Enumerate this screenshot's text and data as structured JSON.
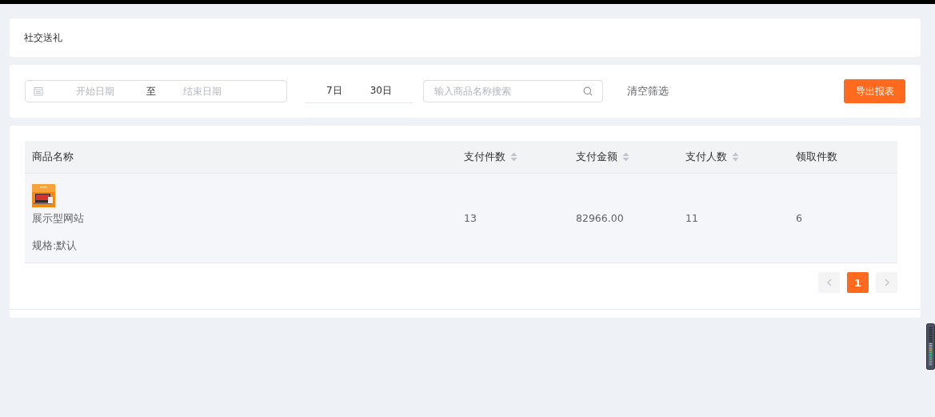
{
  "page_title": "社交送礼",
  "filters": {
    "start_placeholder": "开始日期",
    "separator": "至",
    "end_placeholder": "结束日期",
    "quick_ranges": [
      {
        "label": "7日",
        "selected": false
      },
      {
        "label": "30日",
        "selected": false
      }
    ],
    "search_placeholder": "输入商品名称搜索",
    "clear_label": "清空筛选",
    "export_label": "导出报表"
  },
  "table": {
    "columns": [
      {
        "label": "商品名称",
        "sortable": false
      },
      {
        "label": "支付件数",
        "sortable": true
      },
      {
        "label": "支付金额",
        "sortable": true
      },
      {
        "label": "支付人数",
        "sortable": true
      },
      {
        "label": "领取件数",
        "sortable": false
      }
    ],
    "rows": [
      {
        "cells": [
          {
            "kind": "product",
            "name": "展示型网站",
            "spec": "规格:默认"
          },
          {
            "kind": "text",
            "text": "13"
          },
          {
            "kind": "text",
            "text": "82966.00"
          },
          {
            "kind": "text",
            "text": "11"
          },
          {
            "kind": "text",
            "text": "6"
          }
        ]
      }
    ]
  },
  "pagination": {
    "pages": [
      {
        "label": "1",
        "selected": true
      }
    ]
  }
}
